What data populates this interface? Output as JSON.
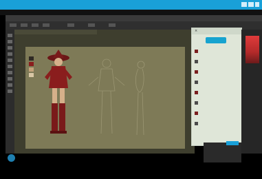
{
  "browser": {
    "tab_text": "",
    "accent": "#19a0d8"
  },
  "app": {
    "menu_items": [
      "",
      "",
      "",
      "",
      "",
      "",
      "",
      ""
    ],
    "doc_tab": ""
  },
  "palette": {
    "header": "",
    "cta": "",
    "rows": [
      {
        "label": "",
        "icon_color": "#7a1f1f"
      },
      {
        "label": "",
        "icon_color": "#4b4b4b"
      },
      {
        "label": "",
        "icon_color": "#7a1f1f"
      },
      {
        "label": "",
        "icon_color": "#4b4b4b"
      },
      {
        "label": "",
        "icon_color": "#7a1f1f"
      },
      {
        "label": "",
        "icon_color": "#4b4b4b"
      },
      {
        "label": "",
        "icon_color": "#7a1f1f"
      },
      {
        "label": "",
        "icon_color": "#4b4b4b"
      }
    ],
    "accent": "#17a3cf"
  },
  "colors": {
    "canvas": "#7e7a57",
    "workspace": "#3e3e2e",
    "character_red": "#8a1d1d",
    "sketch_line": "#9b9673"
  },
  "swatches": [
    "#2f2a24",
    "#8a1d1d",
    "#c2a27a",
    "#d9c7a6"
  ]
}
